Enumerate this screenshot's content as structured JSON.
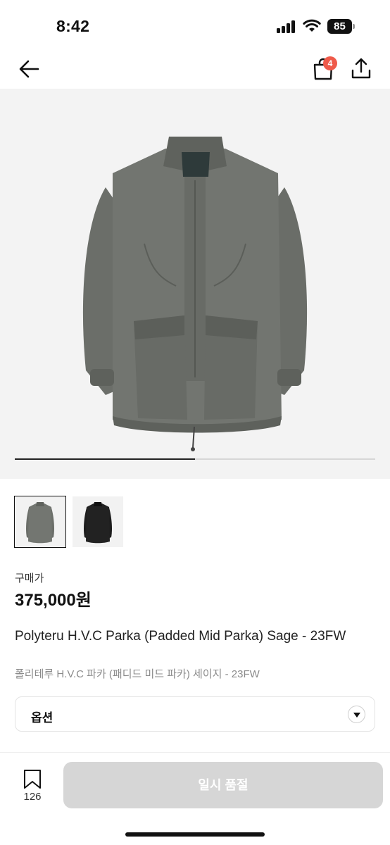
{
  "status_bar": {
    "time": "8:42",
    "battery": "85"
  },
  "nav": {
    "cart_badge": "4"
  },
  "gallery": {
    "progress": 0.5,
    "thumbnail_count": 2
  },
  "product": {
    "price_label": "구매가",
    "price": "375,000원",
    "title": "Polyteru H.V.C Parka (Padded Mid Parka) Sage - 23FW",
    "subtitle": "폴리테루 H.V.C 파카 (패디드 미드 파카) 세이지 - 23FW"
  },
  "option": {
    "label": "옵션"
  },
  "bottom_bar": {
    "bookmark_count": "126",
    "buy_button_label": "일시 품절"
  },
  "colors": {
    "accent_badge": "#ef5a4a",
    "disabled_button": "#d6d6d6",
    "jacket_sage": "#6e716c"
  },
  "icons": [
    "signal-icon",
    "wifi-icon",
    "battery-icon",
    "back-arrow-icon",
    "shopping-bag-icon",
    "share-icon",
    "chevron-down-icon",
    "bookmark-icon"
  ]
}
